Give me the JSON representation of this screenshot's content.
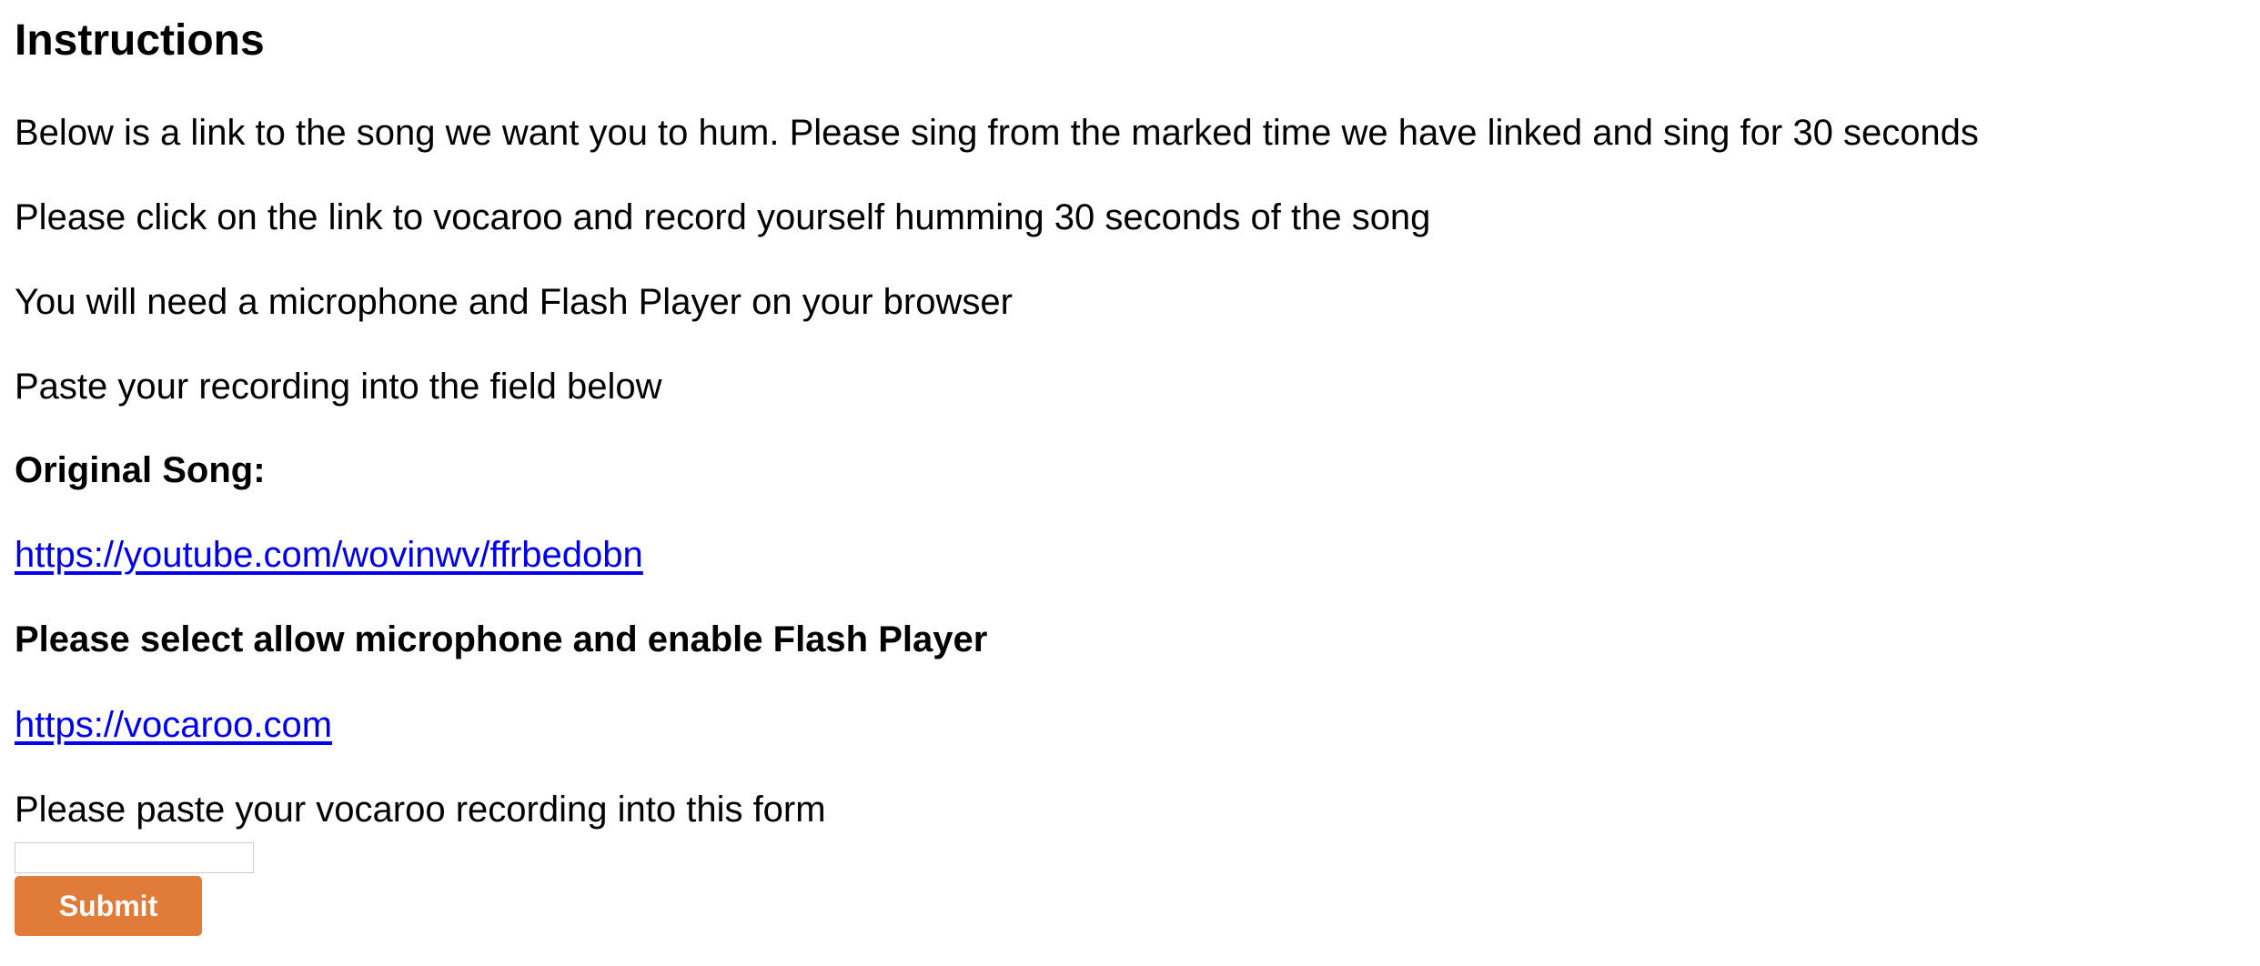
{
  "heading": "Instructions",
  "instructions": [
    "Below is a link to the song we want you to hum. Please sing from the marked time we have linked and sing for 30 seconds",
    "Please click on the link to vocaroo and record yourself humming 30 seconds of the song",
    "You will need a microphone and Flash Player on your browser",
    "Paste your recording into the field below"
  ],
  "original_song": {
    "label": "Original Song:",
    "url": "https://youtube.com/wovinwv/ffrbedobn"
  },
  "permission_note": "Please select allow microphone and enable Flash Player",
  "recorder": {
    "url": "https://vocaroo.com"
  },
  "form": {
    "prompt": "Please paste your vocaroo recording into this form",
    "input_value": "",
    "submit_label": "Submit"
  },
  "colors": {
    "link": "#0000ee",
    "submit_bg": "#e07b39",
    "submit_text": "#ffffff"
  }
}
